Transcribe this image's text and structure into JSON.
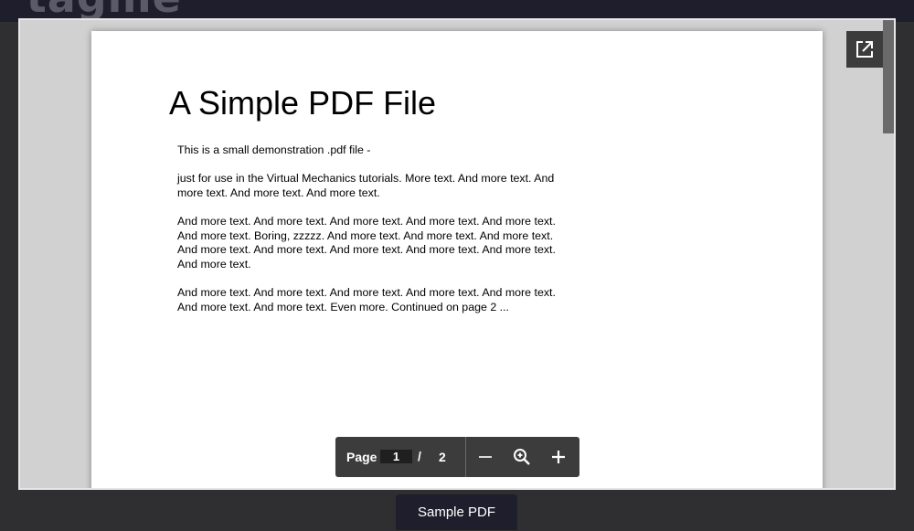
{
  "background_heading": "r tagme",
  "document": {
    "title": "A Simple PDF File",
    "paragraphs": [
      "This is a small demonstration .pdf file -",
      "just for use in the Virtual Mechanics tutorials. More text. And more text. And more text. And more text. And more text.",
      "And more text. And more text. And more text. And more text. And more text. And more text. Boring, zzzzz. And more text. And more text. And more text. And more text. And more text. And more text. And more text. And more text. And more text.",
      "And more text. And more text. And more text. And more text. And more text. And more text. And more text. Even more. Continued on page 2 ..."
    ]
  },
  "toolbar": {
    "page_label": "Page",
    "current_page": "1",
    "separator": "/",
    "total_pages": "2",
    "icons": [
      "zoom-out-icon",
      "zoom-reset-icon",
      "zoom-in-icon"
    ]
  },
  "popout_icon": "open-in-new-icon",
  "caption": "Sample PDF",
  "colors": {
    "page_bg": "#2f2f31",
    "header_bar": "#1f1e2c",
    "viewer_bg": "#d1d1d1",
    "toolbar_bg": "#3c3c3c"
  }
}
